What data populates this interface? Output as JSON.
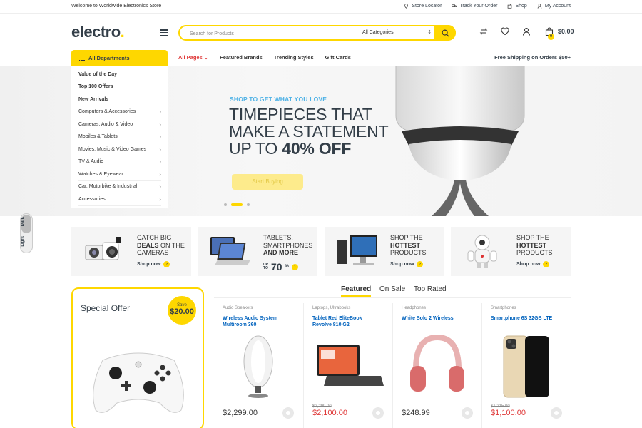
{
  "topbar": {
    "welcome": "Welcome to Worldwide Electronics Store",
    "links": [
      "Store Locator",
      "Track Your Order",
      "Shop",
      "My Account"
    ]
  },
  "header": {
    "logo_text": "electro",
    "logo_dot": ".",
    "search_placeholder": "Search for Products",
    "category_selected": "All Categories",
    "cart_count": "0",
    "cart_total": "$0.00"
  },
  "nav": {
    "all_departments": "All Departments",
    "links": [
      "All Pages",
      "Featured Brands",
      "Trending Styles",
      "Gift Cards"
    ],
    "shipping": "Free Shipping on Orders $50+"
  },
  "departments": [
    {
      "label": "Value of the Day",
      "bold": true
    },
    {
      "label": "Top 100 Offers",
      "bold": true
    },
    {
      "label": "New Arrivals",
      "bold": true
    },
    {
      "label": "Computers & Accessories",
      "bold": false
    },
    {
      "label": "Cameras, Audio & Video",
      "bold": false
    },
    {
      "label": "Mobiles & Tablets",
      "bold": false
    },
    {
      "label": "Movies, Music & Video Games",
      "bold": false
    },
    {
      "label": "TV & Audio",
      "bold": false
    },
    {
      "label": "Watches & Eyewear",
      "bold": false
    },
    {
      "label": "Car, Motorbike & Industrial",
      "bold": false
    },
    {
      "label": "Accessories",
      "bold": false
    }
  ],
  "hero": {
    "tag": "SHOP TO GET WHAT YOU LOVE",
    "line1": "TIMEPIECES THAT",
    "line2": "MAKE A STATEMENT",
    "line3_pre": "UP TO ",
    "line3_bold": "40% OFF",
    "button": "Start Buying"
  },
  "toggle": {
    "dark": "Dark",
    "light": "Light"
  },
  "promos": [
    {
      "l1": "CATCH BIG",
      "l2b": "DEALS",
      "l2": " ON THE",
      "l3": "CAMERAS",
      "shop": "Shop now"
    },
    {
      "l1": "TABLETS,",
      "l2": "SMARTPHONES",
      "l3b": "AND MORE",
      "up": "UP",
      "to": "TO",
      "pct": "70",
      "pctsym": "%"
    },
    {
      "l1": "SHOP THE",
      "l2b": "HOTTEST",
      "l3": "PRODUCTS",
      "shop": "Shop now"
    },
    {
      "l1": "SHOP THE",
      "l2b": "HOTTEST",
      "l3": "PRODUCTS",
      "shop": "Shop now"
    }
  ],
  "special": {
    "title": "Special Offer",
    "save": "Save",
    "amount": "$20.00"
  },
  "tabs": [
    "Featured",
    "On Sale",
    "Top Rated"
  ],
  "products": [
    {
      "category": "Audio Speakers",
      "name": "Wireless Audio System Multiroom 360",
      "old": "",
      "price": "$2,299.00",
      "sale": false
    },
    {
      "category": "Laptops, Ultrabooks",
      "name": "Tablet Red EliteBook Revolve 810 G2",
      "old": "$2,299.00",
      "price": "$2,100.00",
      "sale": true
    },
    {
      "category": "Headphones",
      "name": "White Solo 2 Wireless",
      "old": "",
      "price": "$248.99",
      "sale": false
    },
    {
      "category": "Smartphones",
      "name": "Smartphone 6S 32GB LTE",
      "old": "$1,215.00",
      "price": "$1,100.00",
      "sale": true
    }
  ],
  "colors": {
    "accent": "#fed700",
    "link": "#0062bd",
    "sale": "#df3737",
    "tag": "#4fb2e6"
  }
}
